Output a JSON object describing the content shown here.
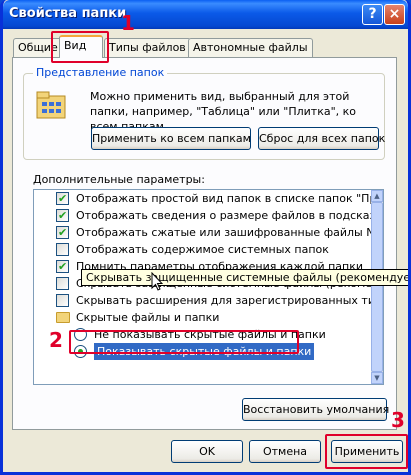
{
  "window": {
    "title": "Свойства папки",
    "help_label": "?",
    "close_label": "×"
  },
  "markers": [
    "1",
    "2",
    "3"
  ],
  "tabs": [
    {
      "label": "Общие"
    },
    {
      "label": "Вид",
      "active": true
    },
    {
      "label": "Типы файлов"
    },
    {
      "label": "Автономные файлы"
    }
  ],
  "folder_view": {
    "title": "Представление папок",
    "description": "Можно применить вид, выбранный для этой папки, например, \"Таблица\" или \"Плитка\", ко всем папкам.",
    "apply_all_label": "Применить ко всем папкам",
    "reset_all_label": "Сброс для всех папок"
  },
  "advanced": {
    "label": "Дополнительные параметры:",
    "items": [
      {
        "type": "checkbox",
        "checked": true,
        "label": "Отображать простой вид папок в списке папок \"Проводни"
      },
      {
        "type": "checkbox",
        "checked": true,
        "label": "Отображать сведения о размере файлов в подсказках па"
      },
      {
        "type": "checkbox",
        "checked": true,
        "label": "Отображать сжатые или зашифрованные файлы NTFS др"
      },
      {
        "type": "checkbox",
        "checked": false,
        "label": "Отображать содержимое системных папок"
      },
      {
        "type": "checkbox",
        "checked": true,
        "label": "Помнить параметры отображения каждой папки"
      },
      {
        "type": "checkbox",
        "checked": false,
        "label": "Скрывать защищенные системные файлы (рекомендуется)"
      },
      {
        "type": "checkbox",
        "checked": false,
        "label": "Скрывать расширения для зарегистрированных типов файлов"
      },
      {
        "type": "folder",
        "label": "Скрытые файлы и папки"
      },
      {
        "type": "radio",
        "checked": false,
        "label": "Не показывать скрытые файлы и папки"
      },
      {
        "type": "radio",
        "checked": true,
        "selected": true,
        "label": "Показывать скрытые файлы и папки"
      }
    ],
    "tooltip": "Скрывать защищенные системные файлы (рекомендуется)"
  },
  "restore_defaults_label": "Восстановить умолчания",
  "footer": {
    "ok_label": "OK",
    "cancel_label": "Отмена",
    "apply_label": "Применить"
  },
  "colors": {
    "annotation": "#e0002a",
    "titlebar": "#0a5ae8",
    "selection": "#316ac5"
  }
}
